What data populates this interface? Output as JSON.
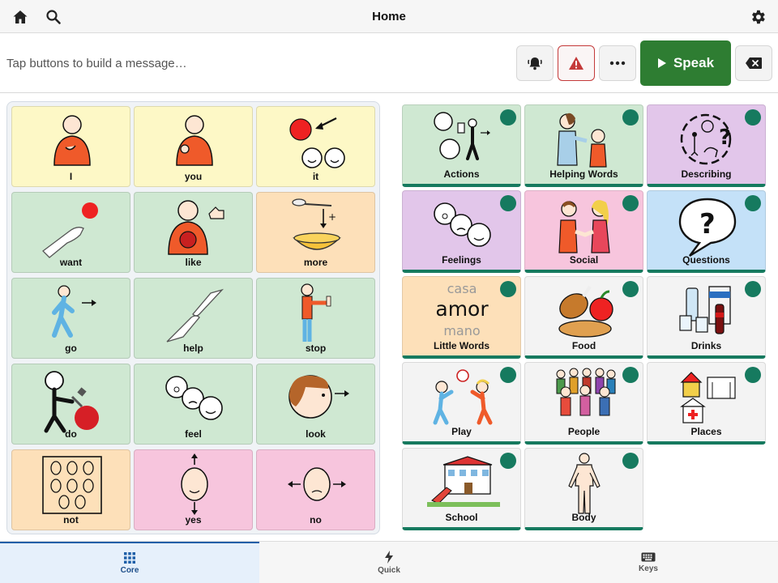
{
  "header": {
    "title": "Home",
    "icons": {
      "home": "home-icon",
      "search": "search-icon",
      "settings": "gear-icon"
    }
  },
  "message_bar": {
    "placeholder": "Tap buttons to build a message…",
    "value": "",
    "speak_label": "Speak",
    "icons": [
      "bell-ring-icon",
      "warning-icon",
      "more-icon",
      "play-icon",
      "backspace-icon"
    ]
  },
  "core": {
    "tiles": [
      {
        "label": "I",
        "color": "#fdf8c6"
      },
      {
        "label": "you",
        "color": "#fdf8c6"
      },
      {
        "label": "it",
        "color": "#fdf8c6"
      },
      {
        "label": "want",
        "color": "#cfe8d2"
      },
      {
        "label": "like",
        "color": "#cfe8d2"
      },
      {
        "label": "more",
        "color": "#fde0b9"
      },
      {
        "label": "go",
        "color": "#cfe8d2"
      },
      {
        "label": "help",
        "color": "#cfe8d2"
      },
      {
        "label": "stop",
        "color": "#cfe8d2"
      },
      {
        "label": "do",
        "color": "#cfe8d2"
      },
      {
        "label": "feel",
        "color": "#cfe8d2"
      },
      {
        "label": "look",
        "color": "#cfe8d2"
      },
      {
        "label": "not",
        "color": "#fde0b9"
      },
      {
        "label": "yes",
        "color": "#f7c5dd"
      },
      {
        "label": "no",
        "color": "#f7c5dd"
      }
    ]
  },
  "categories": {
    "little_words": {
      "top": "casa",
      "middle": "amor",
      "bottom": "mano"
    },
    "tiles": [
      {
        "label": "Actions",
        "color": "#cfe8d2"
      },
      {
        "label": "Helping Words",
        "color": "#cfe8d2"
      },
      {
        "label": "Describing",
        "color": "#e2c6ea"
      },
      {
        "label": "Feelings",
        "color": "#e2c6ea"
      },
      {
        "label": "Social",
        "color": "#f7c5dd"
      },
      {
        "label": "Questions",
        "color": "#c4e1f8"
      },
      {
        "label": "Little Words",
        "color": "#fde0b9"
      },
      {
        "label": "Food",
        "color": "#f3f3f3"
      },
      {
        "label": "Drinks",
        "color": "#f3f3f3"
      },
      {
        "label": "Play",
        "color": "#f3f3f3"
      },
      {
        "label": "People",
        "color": "#f3f3f3"
      },
      {
        "label": "Places",
        "color": "#f3f3f3"
      },
      {
        "label": "School",
        "color": "#f3f3f3"
      },
      {
        "label": "Body",
        "color": "#f3f3f3"
      }
    ]
  },
  "tabs": [
    {
      "label": "Core",
      "active": true,
      "icon": "grid-icon"
    },
    {
      "label": "Quick",
      "active": false,
      "icon": "lightning-icon"
    },
    {
      "label": "Keys",
      "active": false,
      "icon": "keyboard-icon"
    }
  ],
  "colors": {
    "accent_green": "#2e7d32",
    "category_accent": "#167a5f",
    "alert_red": "#c43a3a",
    "active_tab": "#1f5fa8"
  }
}
